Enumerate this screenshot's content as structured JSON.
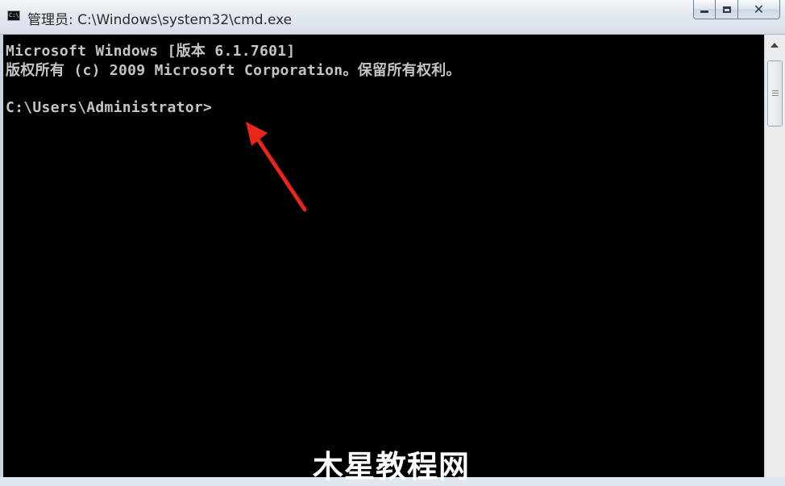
{
  "window": {
    "title": "管理员: C:\\Windows\\system32\\cmd.exe",
    "icon_text": "C:\\"
  },
  "console": {
    "lines": [
      "Microsoft Windows [版本 6.1.7601]",
      "版权所有 (c) 2009 Microsoft Corporation。保留所有权利。",
      "C:\\Users\\Administrator>"
    ]
  },
  "annotation": {
    "arrow_color": "#e8261c"
  },
  "watermark": {
    "text": "木星教程网"
  },
  "icons": [
    "cmd-app-icon",
    "minimize-icon",
    "maximize-icon",
    "close-icon",
    "scroll-up-icon"
  ]
}
